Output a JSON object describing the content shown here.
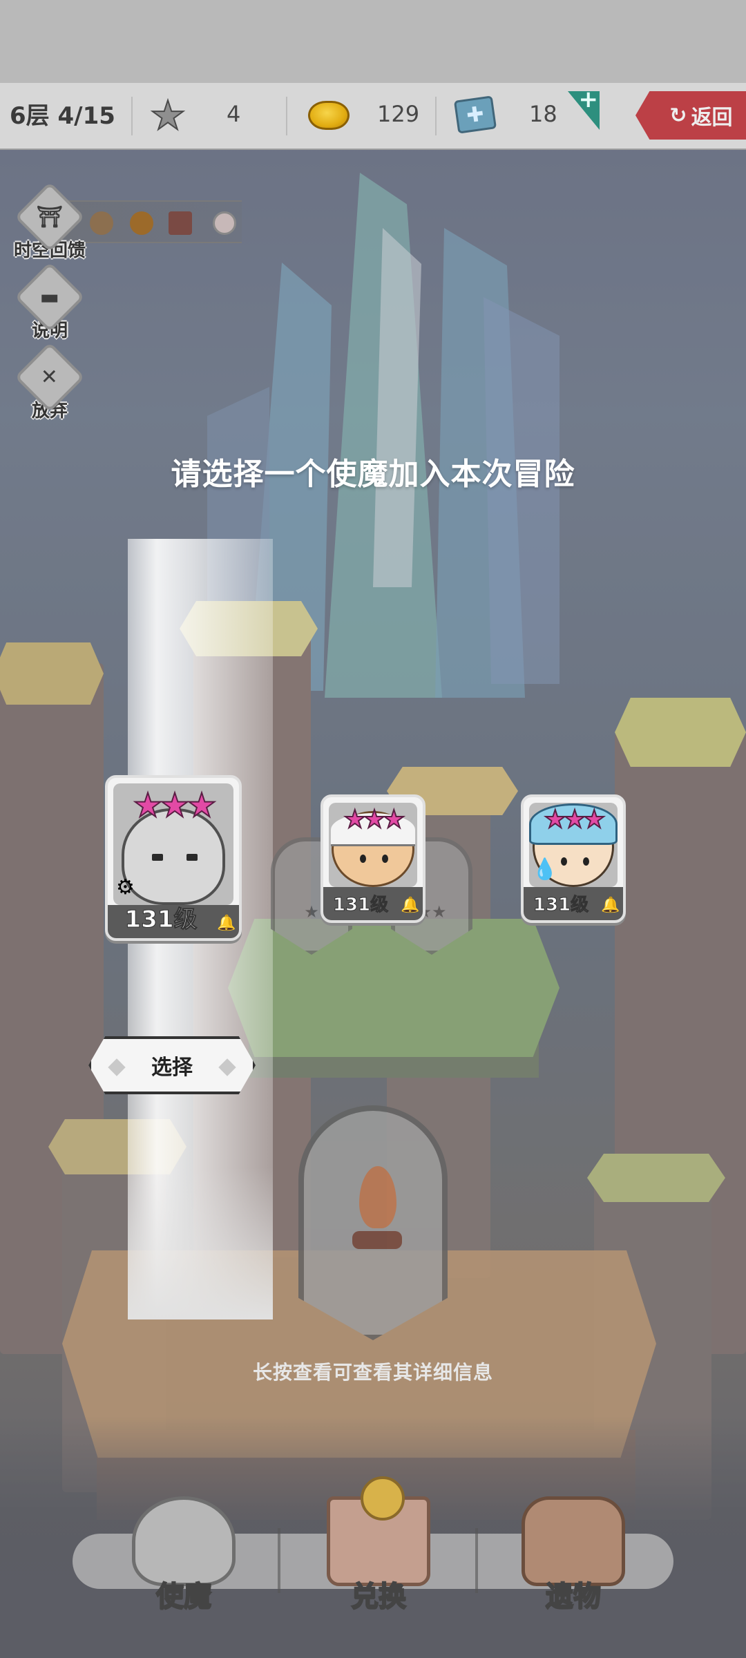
{
  "status_bar": {
    "floor": "6层 4/15",
    "stars": "4",
    "gold": "129",
    "tickets": "18",
    "return_label": "返回"
  },
  "side_menu": [
    {
      "label": "时空回馈",
      "icon": "portal-icon"
    },
    {
      "label": "说明",
      "icon": "chat-icon"
    },
    {
      "label": "放弃",
      "icon": "crossed-swords-icon"
    }
  ],
  "prompt": "请选择一个使魔加入本次冒险",
  "hint": "长按查看可查看其详细信息",
  "select_label": "选择",
  "cards": [
    {
      "name": "white-dragon",
      "stars": "★★★",
      "level": "131级",
      "element": "gear-icon"
    },
    {
      "name": "bandaged-mummy",
      "stars": "★★★",
      "level": "131级",
      "element": ""
    },
    {
      "name": "blue-helmet-knight",
      "stars": "★★★",
      "level": "131级",
      "element": "water-drop-icon"
    }
  ],
  "pins": [
    {
      "stars": "★"
    },
    {
      "stars": "★★"
    }
  ],
  "bottom_nav": [
    {
      "label": "使魔",
      "icon": "knight-helmet-icon"
    },
    {
      "label": "兑换",
      "icon": "shop-icon"
    },
    {
      "label": "遗物",
      "icon": "backpack-icon"
    }
  ],
  "colors": {
    "return_button": "#b8262d",
    "star_pink": "#e24aa5",
    "gold": "#e2ad12"
  }
}
